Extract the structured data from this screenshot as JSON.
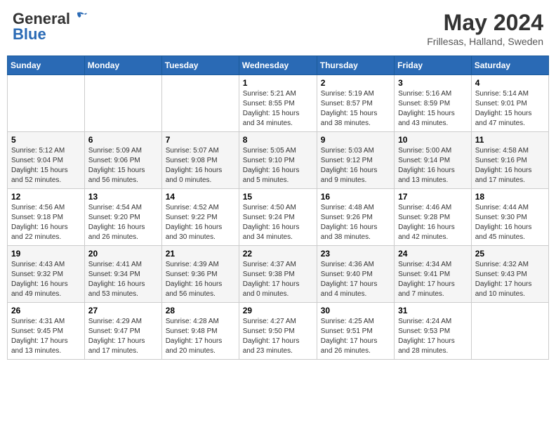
{
  "header": {
    "logo_general": "General",
    "logo_blue": "Blue",
    "month_title": "May 2024",
    "location": "Frillesas, Halland, Sweden"
  },
  "weekdays": [
    "Sunday",
    "Monday",
    "Tuesday",
    "Wednesday",
    "Thursday",
    "Friday",
    "Saturday"
  ],
  "weeks": [
    [
      {
        "day": "",
        "info": ""
      },
      {
        "day": "",
        "info": ""
      },
      {
        "day": "",
        "info": ""
      },
      {
        "day": "1",
        "info": "Sunrise: 5:21 AM\nSunset: 8:55 PM\nDaylight: 15 hours\nand 34 minutes."
      },
      {
        "day": "2",
        "info": "Sunrise: 5:19 AM\nSunset: 8:57 PM\nDaylight: 15 hours\nand 38 minutes."
      },
      {
        "day": "3",
        "info": "Sunrise: 5:16 AM\nSunset: 8:59 PM\nDaylight: 15 hours\nand 43 minutes."
      },
      {
        "day": "4",
        "info": "Sunrise: 5:14 AM\nSunset: 9:01 PM\nDaylight: 15 hours\nand 47 minutes."
      }
    ],
    [
      {
        "day": "5",
        "info": "Sunrise: 5:12 AM\nSunset: 9:04 PM\nDaylight: 15 hours\nand 52 minutes."
      },
      {
        "day": "6",
        "info": "Sunrise: 5:09 AM\nSunset: 9:06 PM\nDaylight: 15 hours\nand 56 minutes."
      },
      {
        "day": "7",
        "info": "Sunrise: 5:07 AM\nSunset: 9:08 PM\nDaylight: 16 hours\nand 0 minutes."
      },
      {
        "day": "8",
        "info": "Sunrise: 5:05 AM\nSunset: 9:10 PM\nDaylight: 16 hours\nand 5 minutes."
      },
      {
        "day": "9",
        "info": "Sunrise: 5:03 AM\nSunset: 9:12 PM\nDaylight: 16 hours\nand 9 minutes."
      },
      {
        "day": "10",
        "info": "Sunrise: 5:00 AM\nSunset: 9:14 PM\nDaylight: 16 hours\nand 13 minutes."
      },
      {
        "day": "11",
        "info": "Sunrise: 4:58 AM\nSunset: 9:16 PM\nDaylight: 16 hours\nand 17 minutes."
      }
    ],
    [
      {
        "day": "12",
        "info": "Sunrise: 4:56 AM\nSunset: 9:18 PM\nDaylight: 16 hours\nand 22 minutes."
      },
      {
        "day": "13",
        "info": "Sunrise: 4:54 AM\nSunset: 9:20 PM\nDaylight: 16 hours\nand 26 minutes."
      },
      {
        "day": "14",
        "info": "Sunrise: 4:52 AM\nSunset: 9:22 PM\nDaylight: 16 hours\nand 30 minutes."
      },
      {
        "day": "15",
        "info": "Sunrise: 4:50 AM\nSunset: 9:24 PM\nDaylight: 16 hours\nand 34 minutes."
      },
      {
        "day": "16",
        "info": "Sunrise: 4:48 AM\nSunset: 9:26 PM\nDaylight: 16 hours\nand 38 minutes."
      },
      {
        "day": "17",
        "info": "Sunrise: 4:46 AM\nSunset: 9:28 PM\nDaylight: 16 hours\nand 42 minutes."
      },
      {
        "day": "18",
        "info": "Sunrise: 4:44 AM\nSunset: 9:30 PM\nDaylight: 16 hours\nand 45 minutes."
      }
    ],
    [
      {
        "day": "19",
        "info": "Sunrise: 4:43 AM\nSunset: 9:32 PM\nDaylight: 16 hours\nand 49 minutes."
      },
      {
        "day": "20",
        "info": "Sunrise: 4:41 AM\nSunset: 9:34 PM\nDaylight: 16 hours\nand 53 minutes."
      },
      {
        "day": "21",
        "info": "Sunrise: 4:39 AM\nSunset: 9:36 PM\nDaylight: 16 hours\nand 56 minutes."
      },
      {
        "day": "22",
        "info": "Sunrise: 4:37 AM\nSunset: 9:38 PM\nDaylight: 17 hours\nand 0 minutes."
      },
      {
        "day": "23",
        "info": "Sunrise: 4:36 AM\nSunset: 9:40 PM\nDaylight: 17 hours\nand 4 minutes."
      },
      {
        "day": "24",
        "info": "Sunrise: 4:34 AM\nSunset: 9:41 PM\nDaylight: 17 hours\nand 7 minutes."
      },
      {
        "day": "25",
        "info": "Sunrise: 4:32 AM\nSunset: 9:43 PM\nDaylight: 17 hours\nand 10 minutes."
      }
    ],
    [
      {
        "day": "26",
        "info": "Sunrise: 4:31 AM\nSunset: 9:45 PM\nDaylight: 17 hours\nand 13 minutes."
      },
      {
        "day": "27",
        "info": "Sunrise: 4:29 AM\nSunset: 9:47 PM\nDaylight: 17 hours\nand 17 minutes."
      },
      {
        "day": "28",
        "info": "Sunrise: 4:28 AM\nSunset: 9:48 PM\nDaylight: 17 hours\nand 20 minutes."
      },
      {
        "day": "29",
        "info": "Sunrise: 4:27 AM\nSunset: 9:50 PM\nDaylight: 17 hours\nand 23 minutes."
      },
      {
        "day": "30",
        "info": "Sunrise: 4:25 AM\nSunset: 9:51 PM\nDaylight: 17 hours\nand 26 minutes."
      },
      {
        "day": "31",
        "info": "Sunrise: 4:24 AM\nSunset: 9:53 PM\nDaylight: 17 hours\nand 28 minutes."
      },
      {
        "day": "",
        "info": ""
      }
    ]
  ]
}
